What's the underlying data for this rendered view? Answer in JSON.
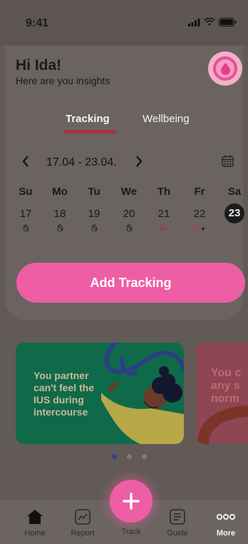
{
  "status": {
    "time": "9:41"
  },
  "greeting": {
    "title": "Hi Ida!",
    "subtitle": "Here are you insights"
  },
  "tabs": {
    "items": [
      "Tracking",
      "Wellbeing"
    ],
    "active": "Tracking"
  },
  "week": {
    "range": "17.04 - 23.04."
  },
  "days": [
    {
      "name": "Su",
      "num": "17",
      "mark": "no-drop-icon"
    },
    {
      "name": "Mo",
      "num": "18",
      "mark": "no-drop-icon"
    },
    {
      "name": "Tu",
      "num": "19",
      "mark": "no-drop-icon"
    },
    {
      "name": "We",
      "num": "20",
      "mark": "no-drop-icon"
    },
    {
      "name": "Th",
      "num": "21",
      "mark": "bubbles-icon"
    },
    {
      "name": "Fr",
      "num": "22",
      "mark": "drop-dot-icon"
    },
    {
      "name": "Sa",
      "num": "23",
      "mark": "selected"
    }
  ],
  "cta": {
    "add_tracking": "Add Tracking"
  },
  "cards": [
    {
      "text": "You partner can't feel the IUS during intercourse"
    },
    {
      "text": "You c any s norm"
    }
  ],
  "nav": {
    "home": "Home",
    "report": "Report",
    "track": "Track",
    "guide": "Guide",
    "more": "More"
  },
  "colors": {
    "accent": "#ee5ea4",
    "card_green": "#0f6a49"
  }
}
